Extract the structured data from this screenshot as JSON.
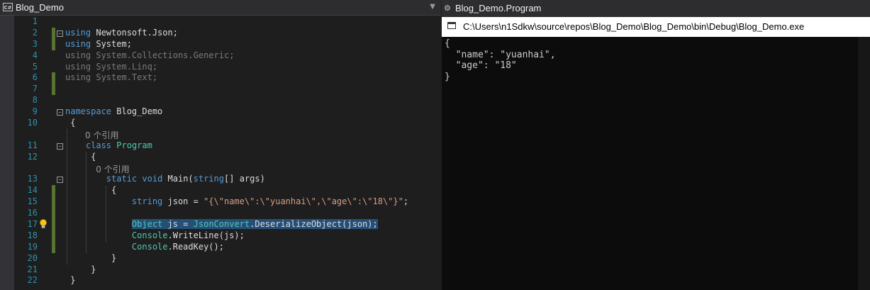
{
  "editor": {
    "file_tab": "Blog_Demo",
    "lang_badge": "C#",
    "lines": [
      {
        "n": "1"
      },
      {
        "n": "2",
        "fold": "−",
        "code": [
          {
            "t": "using",
            "c": "kw"
          },
          {
            "t": " Newtonsoft.Json;"
          }
        ]
      },
      {
        "n": "3",
        "code": [
          {
            "t": "using",
            "c": "kw"
          },
          {
            "t": " System;"
          }
        ]
      },
      {
        "n": "4",
        "code": [
          {
            "t": "using System.Collections.Generic;",
            "c": "gr"
          }
        ]
      },
      {
        "n": "5",
        "code": [
          {
            "t": "using System.Linq;",
            "c": "gr"
          }
        ]
      },
      {
        "n": "6",
        "code": [
          {
            "t": "using System.Text;",
            "c": "gr"
          }
        ]
      },
      {
        "n": "7"
      },
      {
        "n": "8"
      },
      {
        "n": "9",
        "fold": "−",
        "code": [
          {
            "t": "namespace",
            "c": "kw"
          },
          {
            "t": " Blog_Demo"
          }
        ]
      },
      {
        "n": "10",
        "code": [
          {
            "t": " {"
          }
        ]
      },
      {
        "n": "",
        "ghost": "0 个引用"
      },
      {
        "n": "11",
        "fold": "−",
        "code": [
          {
            "t": "    "
          },
          {
            "t": "class",
            "c": "kw"
          },
          {
            "t": " "
          },
          {
            "t": "Program",
            "c": "ty"
          }
        ]
      },
      {
        "n": "12",
        "code": [
          {
            "t": "     {"
          }
        ]
      },
      {
        "n": "",
        "ghost": "    0 个引用"
      },
      {
        "n": "13",
        "fold": "−",
        "code": [
          {
            "t": "        "
          },
          {
            "t": "static",
            "c": "kw"
          },
          {
            "t": " "
          },
          {
            "t": "void",
            "c": "kw"
          },
          {
            "t": " Main("
          },
          {
            "t": "string",
            "c": "kw"
          },
          {
            "t": "[] args)"
          }
        ]
      },
      {
        "n": "14",
        "code": [
          {
            "t": "         {"
          }
        ]
      },
      {
        "n": "15",
        "code": [
          {
            "t": "             "
          },
          {
            "t": "string",
            "c": "kw"
          },
          {
            "t": " json = "
          },
          {
            "t": "\"{\\\"name\\\":\\\"yuanhai\\\",\\\"age\\\":\\\"18\\\"}\"",
            "c": "st"
          },
          {
            "t": ";"
          }
        ]
      },
      {
        "n": "16"
      },
      {
        "n": "17",
        "code": [
          {
            "t": "             "
          },
          {
            "t": "Object",
            "c": "ty sel"
          },
          {
            "t": " js = ",
            "c": "sel"
          },
          {
            "t": "JsonConvert",
            "c": "ty sel"
          },
          {
            "t": ".DeserializeObject(json);",
            "c": "sel"
          }
        ]
      },
      {
        "n": "18",
        "code": [
          {
            "t": "             "
          },
          {
            "t": "Console",
            "c": "ty"
          },
          {
            "t": ".WriteLine(js);"
          }
        ]
      },
      {
        "n": "19",
        "code": [
          {
            "t": "             "
          },
          {
            "t": "Console",
            "c": "ty"
          },
          {
            "t": ".ReadKey();"
          }
        ]
      },
      {
        "n": "20",
        "code": [
          {
            "t": "         }"
          }
        ]
      },
      {
        "n": "21",
        "code": [
          {
            "t": "     }"
          }
        ]
      },
      {
        "n": "22",
        "code": [
          {
            "t": " }"
          }
        ]
      }
    ]
  },
  "console": {
    "window_title": "Blog_Demo.Program",
    "path": "C:\\Users\\n1Sdkw\\source\\repos\\Blog_Demo\\Blog_Demo\\bin\\Debug\\Blog_Demo.exe",
    "output": "{\n  \"name\": \"yuanhai\",\n  \"age\": \"18\"\n}"
  },
  "colors": {
    "keyword": "#569cd6",
    "type": "#4ec9b0",
    "string": "#d69d85",
    "line_number": "#2b91af",
    "selection": "#264f78"
  },
  "icons": {
    "bulb": "lightbulb-icon",
    "fold": "collapse-icon"
  }
}
